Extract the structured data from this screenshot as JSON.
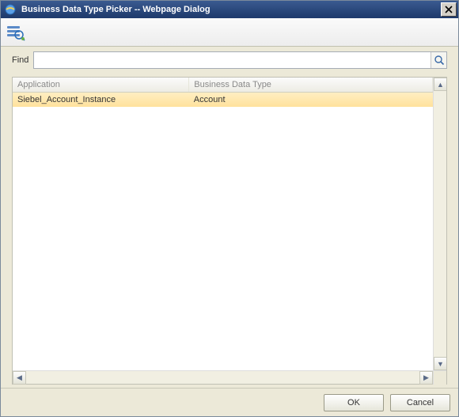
{
  "window": {
    "title": "Business Data Type Picker -- Webpage Dialog"
  },
  "find": {
    "label": "Find",
    "value": "",
    "placeholder": ""
  },
  "table": {
    "columns": [
      "Application",
      "Business Data Type"
    ],
    "rows": [
      {
        "application": "Siebel_Account_Instance",
        "type": "Account",
        "selected": true
      }
    ]
  },
  "buttons": {
    "ok": "OK",
    "cancel": "Cancel"
  }
}
